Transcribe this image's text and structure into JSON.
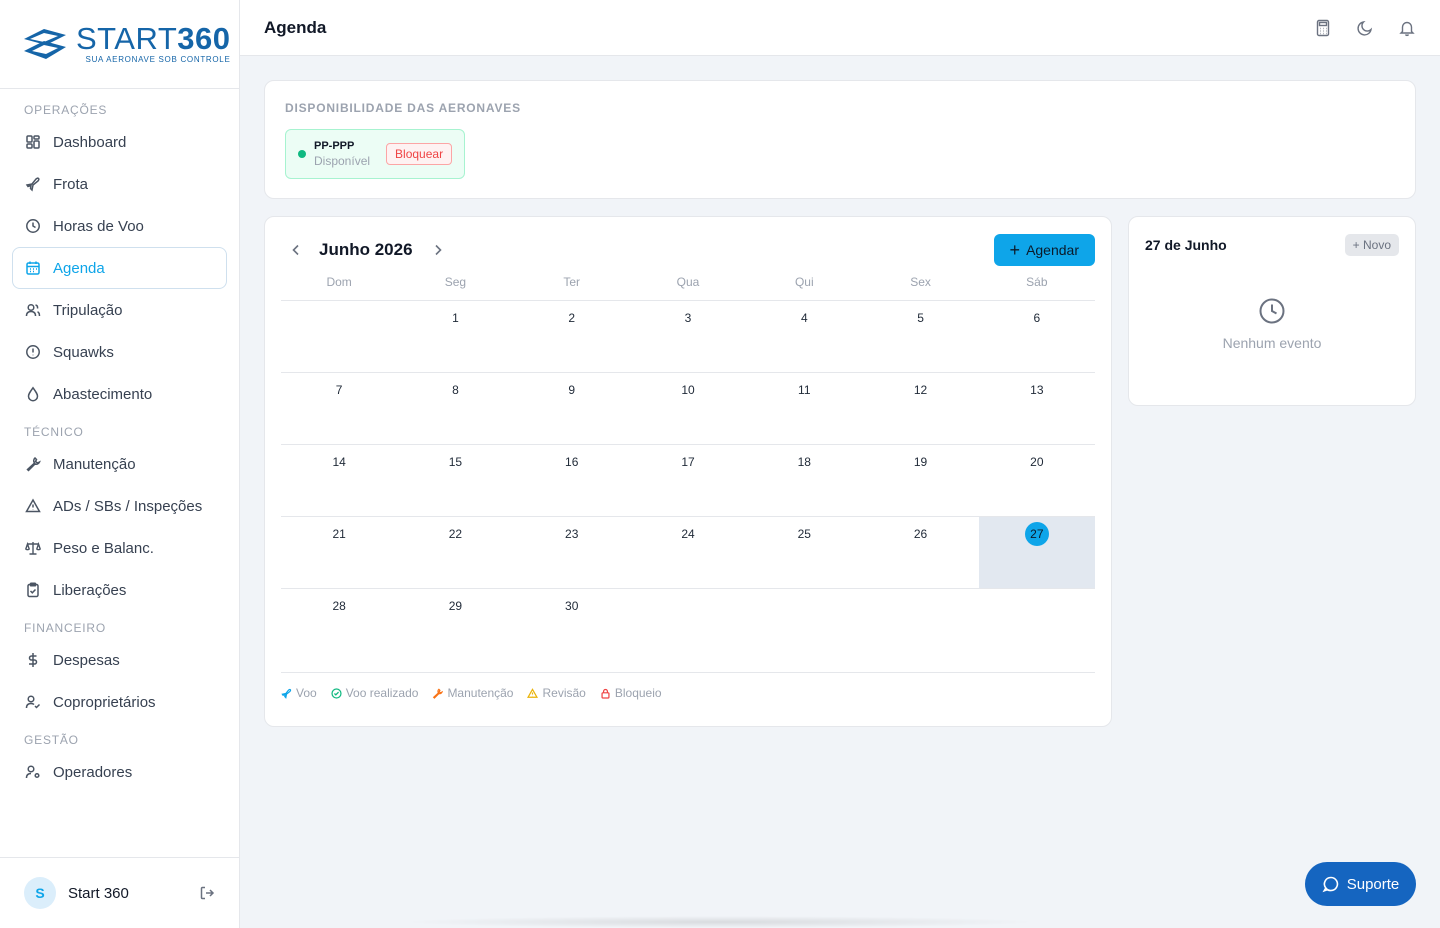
{
  "brand": {
    "name_thin": "START",
    "name_bold": "360",
    "tagline": "SUA AERONAVE SOB CONTROLE",
    "color": "#1565a8"
  },
  "sidebar": {
    "sections": [
      {
        "title": "OPERAÇÕES",
        "items": [
          {
            "label": "Dashboard",
            "icon": "grid-icon"
          },
          {
            "label": "Frota",
            "icon": "plane-icon"
          },
          {
            "label": "Horas de Voo",
            "icon": "clock-icon"
          },
          {
            "label": "Agenda",
            "icon": "calendar-icon",
            "active": true
          },
          {
            "label": "Tripulação",
            "icon": "users-icon"
          },
          {
            "label": "Squawks",
            "icon": "alert-circle-icon"
          },
          {
            "label": "Abastecimento",
            "icon": "droplet-icon"
          }
        ]
      },
      {
        "title": "TÉCNICO",
        "items": [
          {
            "label": "Manutenção",
            "icon": "wrench-icon"
          },
          {
            "label": "ADs / SBs / Inspeções",
            "icon": "warning-triangle-icon"
          },
          {
            "label": "Peso e Balanc.",
            "icon": "scale-icon"
          },
          {
            "label": "Liberações",
            "icon": "clipboard-check-icon"
          }
        ]
      },
      {
        "title": "FINANCEIRO",
        "items": [
          {
            "label": "Despesas",
            "icon": "dollar-icon"
          },
          {
            "label": "Coproprietários",
            "icon": "user-check-icon"
          }
        ]
      },
      {
        "title": "GESTÃO",
        "items": [
          {
            "label": "Operadores",
            "icon": "user-cog-icon"
          }
        ]
      }
    ],
    "user": {
      "initial": "S",
      "name": "Start 360"
    }
  },
  "header": {
    "title": "Agenda",
    "icons": [
      "calculator-icon",
      "moon-icon",
      "bell-icon"
    ]
  },
  "availability": {
    "title": "DISPONIBILIDADE DAS AERONAVES",
    "aircraft": [
      {
        "registration": "PP-PPP",
        "status": "Disponível",
        "action": "Bloquear",
        "status_color": "#10b981"
      }
    ]
  },
  "calendar": {
    "month_label": "Junho 2026",
    "add_button": "Agendar",
    "weekdays": [
      "Dom",
      "Seg",
      "Ter",
      "Qua",
      "Qui",
      "Sex",
      "Sáb"
    ],
    "weeks": [
      [
        "",
        "1",
        "2",
        "3",
        "4",
        "5",
        "6"
      ],
      [
        "7",
        "8",
        "9",
        "10",
        "11",
        "12",
        "13"
      ],
      [
        "14",
        "15",
        "16",
        "17",
        "18",
        "19",
        "20"
      ],
      [
        "21",
        "22",
        "23",
        "24",
        "25",
        "26",
        "27"
      ],
      [
        "28",
        "29",
        "30",
        "",
        "",
        "",
        ""
      ]
    ],
    "selected_day": "27",
    "legend": [
      {
        "label": "Voo",
        "icon": "plane-icon",
        "color": "#0ea5e9"
      },
      {
        "label": "Voo realizado",
        "icon": "check-circle-icon",
        "color": "#10b981"
      },
      {
        "label": "Manutenção",
        "icon": "wrench-icon",
        "color": "#f97316"
      },
      {
        "label": "Revisão",
        "icon": "warning-triangle-icon",
        "color": "#eab308"
      },
      {
        "label": "Bloqueio",
        "icon": "lock-icon",
        "color": "#ef4444"
      }
    ]
  },
  "day_panel": {
    "title": "27 de Junho",
    "new_button": "Novo",
    "empty_text": "Nenhum evento"
  },
  "support": {
    "label": "Suporte"
  },
  "colors": {
    "accent": "#0ea5e9",
    "support": "#1565c0",
    "background": "#f1f4f8"
  }
}
